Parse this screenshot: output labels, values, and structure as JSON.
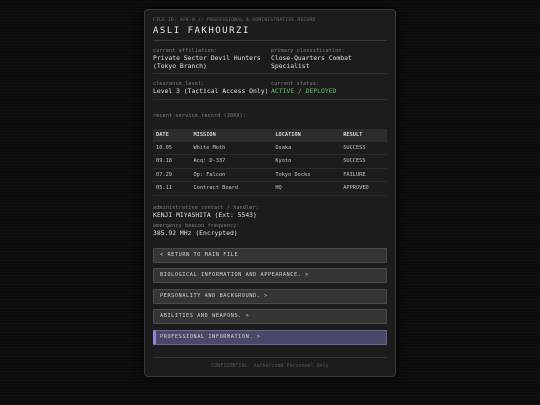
{
  "header": {
    "file_id": "FILE ID: AFK-8 // PROFESSIONAL & ADMINISTRATIVE RECORD",
    "name": "ASLI FAKHOURZI"
  },
  "fields": {
    "affiliation_label": "current affiliation:",
    "affiliation_value": "Private Sector Devil Hunters (Tokyo Branch)",
    "classification_label": "primary classification:",
    "classification_value": "Close-Quarters Combat Specialist",
    "clearance_label": "clearance level:",
    "clearance_value": "Level 3 (Tactical Access Only)",
    "status_label": "current status:",
    "status_value": "ACTIVE / DEPLOYED"
  },
  "service": {
    "label": "recent service record (20XX):",
    "columns": [
      "DATE",
      "MISSION",
      "LOCATION",
      "RESULT"
    ],
    "rows": [
      [
        "10.05",
        "White Moth",
        "Osaka",
        "SUCCESS"
      ],
      [
        "09.18",
        "Acq: D-337",
        "Kyoto",
        "SUCCESS"
      ],
      [
        "07.29",
        "Op: Falcon",
        "Tokyo Docks",
        "FAILURE"
      ],
      [
        "05.11",
        "Contract Board",
        "HQ",
        "APPROVED"
      ]
    ]
  },
  "contact": {
    "handler_label": "administrative contact / handler:",
    "handler_value": "KENJI MIYASHITA (Ext: 5543)",
    "beacon_label": "emergency beacon frequency:",
    "beacon_value": "385.92 MHz (Encrypted)"
  },
  "nav": {
    "return": "< RETURN TO MAIN FILE",
    "bio": "BIOLOGICAL INFORMATION AND APPEARANCE. >",
    "personality": "PERSONALITY AND BACKGROUND. >",
    "abilities": "ABILITIES AND WEAPONS. >",
    "professional": "PROFESSIONAL INFORMATION. >"
  },
  "footer": "CONFIDENTIAL: Authorized Personnel Only",
  "colors": {
    "status_active": "#5ec25e",
    "highlight_button": "#4a4868",
    "highlight_accent": "#8c88d6"
  }
}
